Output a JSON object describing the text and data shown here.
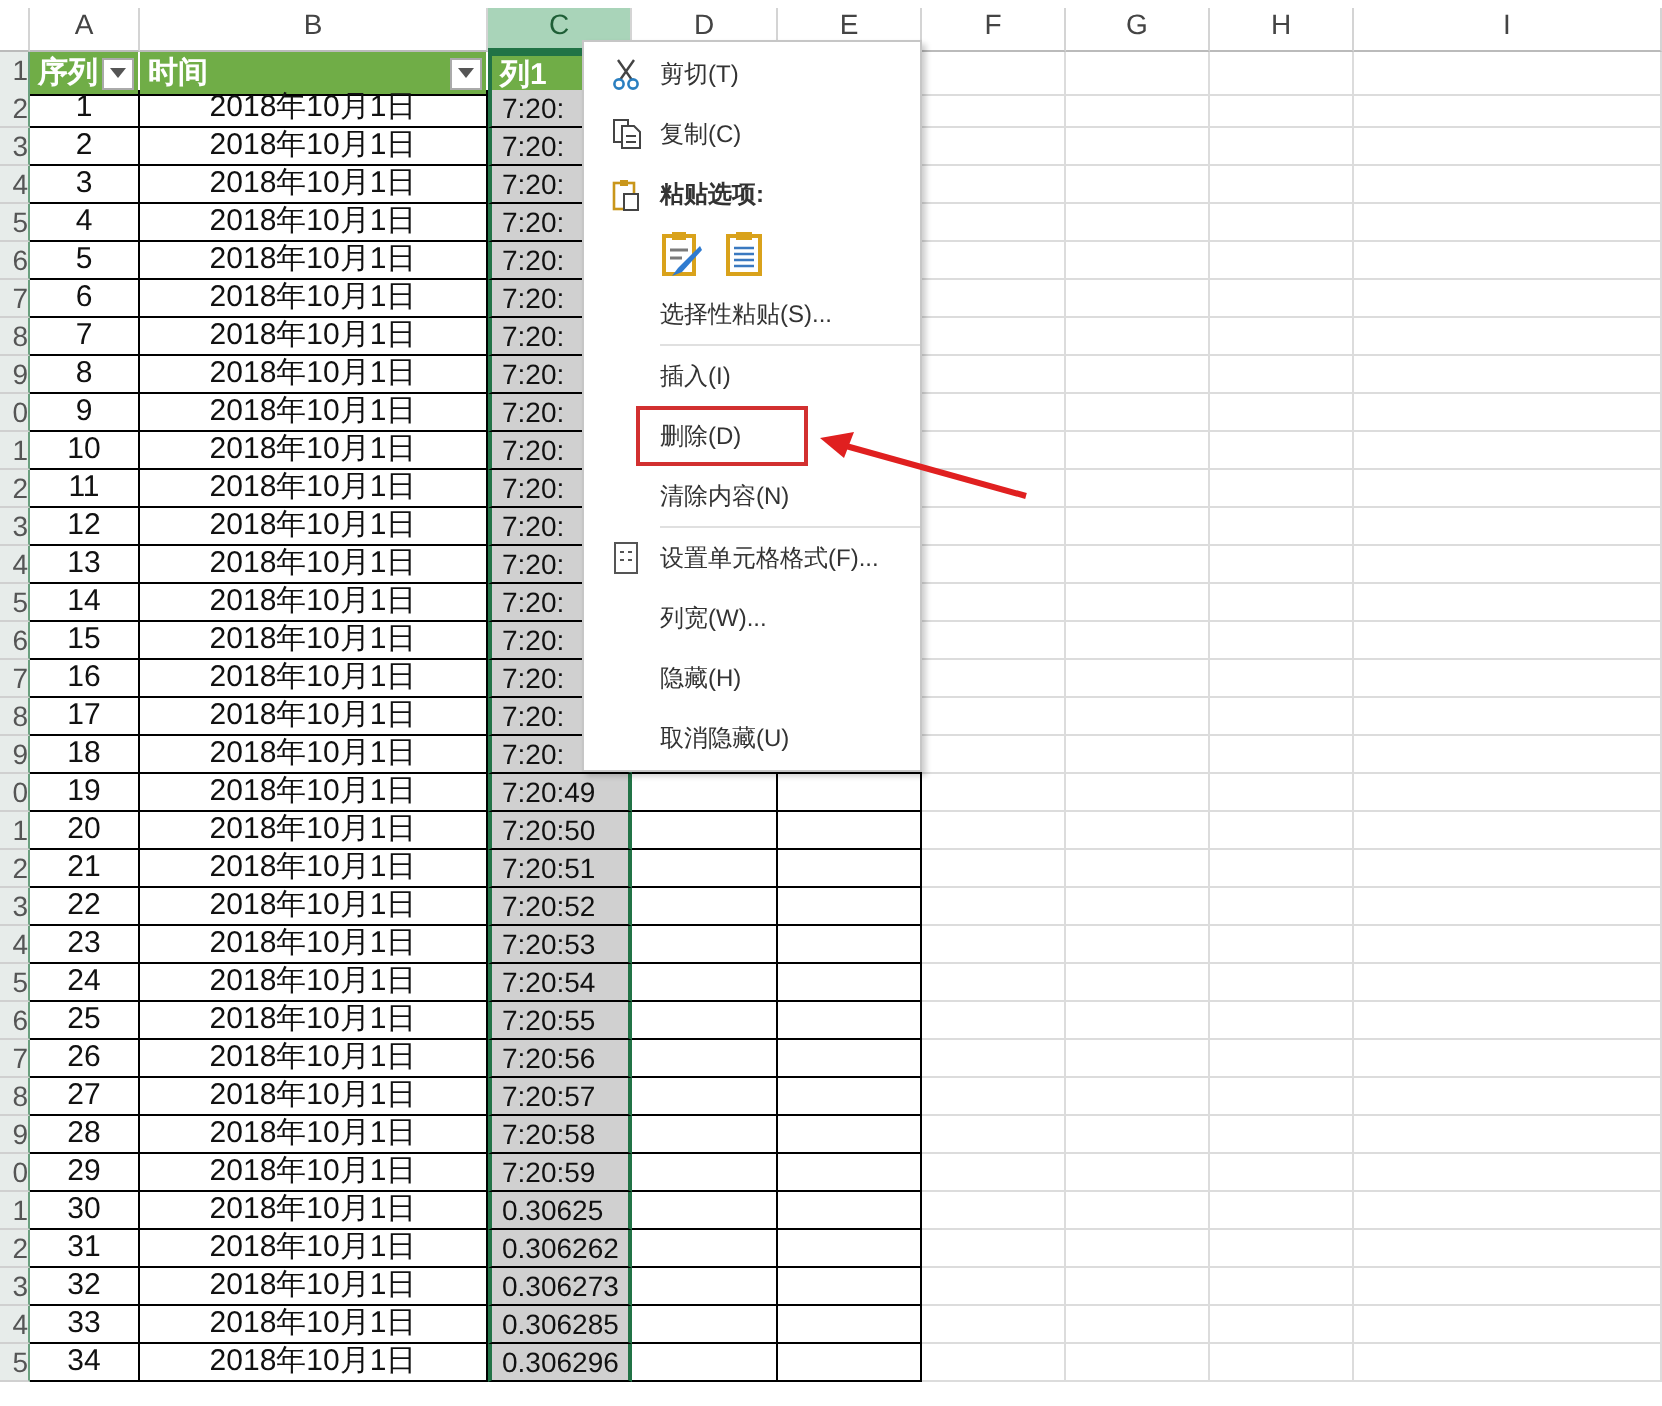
{
  "column_headers": [
    {
      "label": "A",
      "selected": false
    },
    {
      "label": "B",
      "selected": false
    },
    {
      "label": "C",
      "selected": true
    },
    {
      "label": "D",
      "selected": false
    },
    {
      "label": "E",
      "selected": false
    },
    {
      "label": "F",
      "selected": false
    },
    {
      "label": "G",
      "selected": false
    },
    {
      "label": "H",
      "selected": false
    },
    {
      "label": "I",
      "selected": false
    }
  ],
  "table": {
    "header_row_number": "1",
    "columns": [
      {
        "label": "序列",
        "filter": true
      },
      {
        "label": "时间",
        "filter": true
      },
      {
        "label": "列1",
        "filter": false
      }
    ],
    "rows": [
      {
        "row_number": "2",
        "cells": [
          "1",
          "2018年10月1日",
          "7:20:"
        ]
      },
      {
        "row_number": "3",
        "cells": [
          "2",
          "2018年10月1日",
          "7:20:"
        ]
      },
      {
        "row_number": "4",
        "cells": [
          "3",
          "2018年10月1日",
          "7:20:"
        ]
      },
      {
        "row_number": "5",
        "cells": [
          "4",
          "2018年10月1日",
          "7:20:"
        ]
      },
      {
        "row_number": "6",
        "cells": [
          "5",
          "2018年10月1日",
          "7:20:"
        ]
      },
      {
        "row_number": "7",
        "cells": [
          "6",
          "2018年10月1日",
          "7:20:"
        ]
      },
      {
        "row_number": "8",
        "cells": [
          "7",
          "2018年10月1日",
          "7:20:"
        ]
      },
      {
        "row_number": "9",
        "cells": [
          "8",
          "2018年10月1日",
          "7:20:"
        ]
      },
      {
        "row_number": "0",
        "cells": [
          "9",
          "2018年10月1日",
          "7:20:"
        ]
      },
      {
        "row_number": "1",
        "cells": [
          "10",
          "2018年10月1日",
          "7:20:"
        ]
      },
      {
        "row_number": "2",
        "cells": [
          "11",
          "2018年10月1日",
          "7:20:"
        ]
      },
      {
        "row_number": "3",
        "cells": [
          "12",
          "2018年10月1日",
          "7:20:"
        ]
      },
      {
        "row_number": "4",
        "cells": [
          "13",
          "2018年10月1日",
          "7:20:"
        ]
      },
      {
        "row_number": "5",
        "cells": [
          "14",
          "2018年10月1日",
          "7:20:"
        ]
      },
      {
        "row_number": "6",
        "cells": [
          "15",
          "2018年10月1日",
          "7:20:"
        ]
      },
      {
        "row_number": "7",
        "cells": [
          "16",
          "2018年10月1日",
          "7:20:"
        ]
      },
      {
        "row_number": "8",
        "cells": [
          "17",
          "2018年10月1日",
          "7:20:"
        ]
      },
      {
        "row_number": "9",
        "cells": [
          "18",
          "2018年10月1日",
          "7:20:"
        ]
      },
      {
        "row_number": "0",
        "cells": [
          "19",
          "2018年10月1日",
          "7:20:49"
        ]
      },
      {
        "row_number": "1",
        "cells": [
          "20",
          "2018年10月1日",
          "7:20:50"
        ]
      },
      {
        "row_number": "2",
        "cells": [
          "21",
          "2018年10月1日",
          "7:20:51"
        ]
      },
      {
        "row_number": "3",
        "cells": [
          "22",
          "2018年10月1日",
          "7:20:52"
        ]
      },
      {
        "row_number": "4",
        "cells": [
          "23",
          "2018年10月1日",
          "7:20:53"
        ]
      },
      {
        "row_number": "5",
        "cells": [
          "24",
          "2018年10月1日",
          "7:20:54"
        ]
      },
      {
        "row_number": "6",
        "cells": [
          "25",
          "2018年10月1日",
          "7:20:55"
        ]
      },
      {
        "row_number": "7",
        "cells": [
          "26",
          "2018年10月1日",
          "7:20:56"
        ]
      },
      {
        "row_number": "8",
        "cells": [
          "27",
          "2018年10月1日",
          "7:20:57"
        ]
      },
      {
        "row_number": "9",
        "cells": [
          "28",
          "2018年10月1日",
          "7:20:58"
        ]
      },
      {
        "row_number": "0",
        "cells": [
          "29",
          "2018年10月1日",
          "7:20:59"
        ]
      },
      {
        "row_number": "1",
        "cells": [
          "30",
          "2018年10月1日",
          "0.30625"
        ]
      },
      {
        "row_number": "2",
        "cells": [
          "31",
          "2018年10月1日",
          "0.306262"
        ]
      },
      {
        "row_number": "3",
        "cells": [
          "32",
          "2018年10月1日",
          "0.306273"
        ]
      },
      {
        "row_number": "4",
        "cells": [
          "33",
          "2018年10月1日",
          "0.306285"
        ]
      },
      {
        "row_number": "5",
        "cells": [
          "34",
          "2018年10月1日",
          "0.306296"
        ]
      }
    ]
  },
  "context_menu": {
    "items": [
      {
        "kind": "command",
        "label": "剪切(T)",
        "highlighted": false
      },
      {
        "kind": "command",
        "label": "复制(C)",
        "highlighted": false
      },
      {
        "kind": "heading",
        "label": "粘贴选项:",
        "highlighted": false
      },
      {
        "kind": "paste-options"
      },
      {
        "kind": "command",
        "label": "选择性粘贴(S)...",
        "highlighted": false
      },
      {
        "kind": "separator"
      },
      {
        "kind": "command",
        "label": "插入(I)",
        "highlighted": false
      },
      {
        "kind": "command",
        "label": "删除(D)",
        "highlighted": true
      },
      {
        "kind": "command",
        "label": "清除内容(N)",
        "highlighted": false
      },
      {
        "kind": "separator"
      },
      {
        "kind": "command",
        "label": "设置单元格格式(F)...",
        "highlighted": false
      },
      {
        "kind": "command",
        "label": "列宽(W)...",
        "highlighted": false
      },
      {
        "kind": "command",
        "label": "隐藏(H)",
        "highlighted": false
      },
      {
        "kind": "command",
        "label": "取消隐藏(U)",
        "highlighted": false
      }
    ]
  }
}
